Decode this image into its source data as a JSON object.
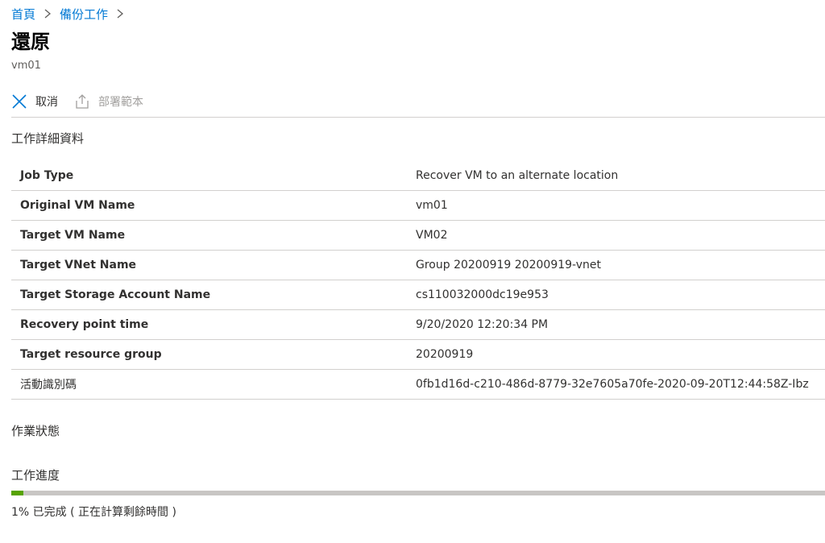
{
  "breadcrumb": {
    "items": [
      "首頁",
      "備份工作"
    ]
  },
  "header": {
    "title": "還原",
    "subtitle": "vm01"
  },
  "toolbar": {
    "cancel_label": "取消",
    "deploy_template_label": "部署範本"
  },
  "job_details": {
    "heading": "工作詳細資料",
    "rows": [
      {
        "key": "Job Type",
        "value": "Recover VM to an alternate location"
      },
      {
        "key": "Original VM Name",
        "value": "vm01"
      },
      {
        "key": "Target VM Name",
        "value": "VM02"
      },
      {
        "key": "Target VNet Name",
        "value": "Group 20200919 20200919-vnet"
      },
      {
        "key": "Target Storage Account Name",
        "value": "cs110032000dc19e953"
      },
      {
        "key": "Recovery point time",
        "value": "9/20/2020 12:20:34 PM"
      },
      {
        "key": "Target resource group",
        "value": "20200919"
      },
      {
        "key": "活動識別碼",
        "value": "0fb1d16d-c210-486d-8779-32e7605a70fe-2020-09-20T12:44:58Z-Ibz"
      }
    ]
  },
  "operation_status": {
    "heading": "作業狀態"
  },
  "job_progress": {
    "heading": "工作進度",
    "percent": 1,
    "text": "1% 已完成 ( 正在計算剩餘時間 )"
  },
  "colors": {
    "link": "#0078d4",
    "progress_fill": "#57a300",
    "progress_track": "#c8c6c4"
  }
}
